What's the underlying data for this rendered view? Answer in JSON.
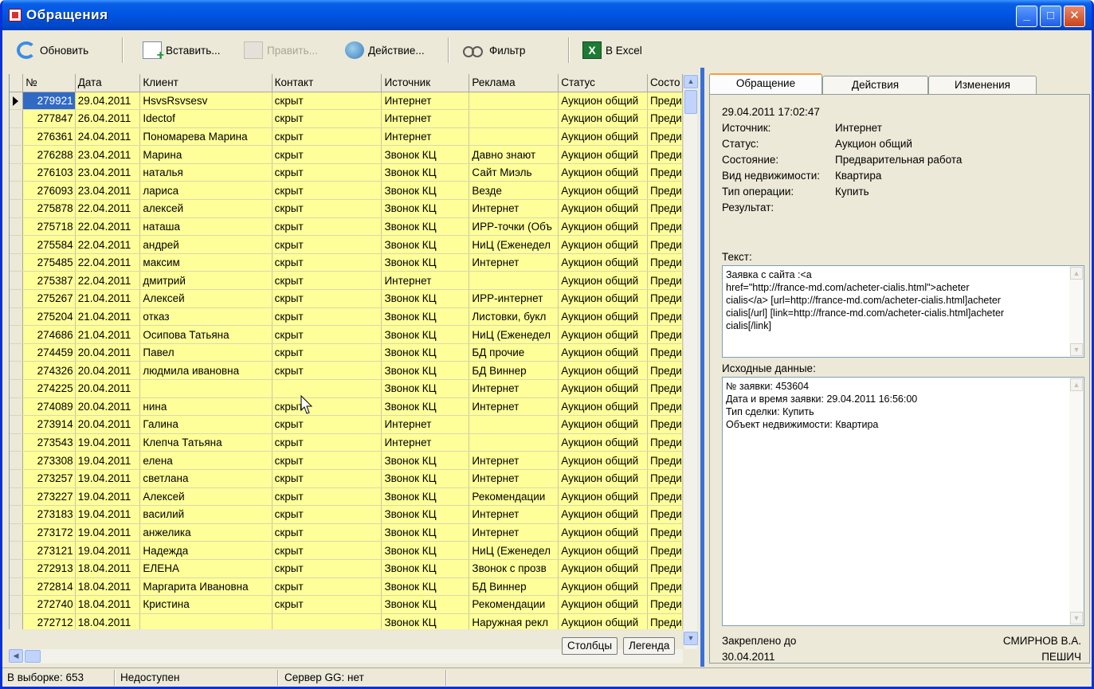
{
  "window": {
    "title": "Обращения"
  },
  "toolbar": {
    "refresh": "Обновить",
    "insert": "Вставить...",
    "edit": "Править...",
    "action": "Действие...",
    "filter": "Фильтр",
    "excel": "В Excel"
  },
  "grid": {
    "columns": [
      "№",
      "Дата",
      "Клиент",
      "Контакт",
      "Источник",
      "Реклама",
      "Статус",
      "Состо"
    ],
    "rows": [
      [
        "279921",
        "29.04.2011",
        "HsvsRsvsesv",
        "скрыт",
        "Интернет",
        "",
        "Аукцион общий",
        "Преди"
      ],
      [
        "277847",
        "26.04.2011",
        "Idectof",
        "скрыт",
        "Интернет",
        "",
        "Аукцион общий",
        "Преди"
      ],
      [
        "276361",
        "24.04.2011",
        "Пономарева Марина",
        "скрыт",
        "Интернет",
        "",
        "Аукцион общий",
        "Преди"
      ],
      [
        "276288",
        "23.04.2011",
        "Марина",
        "скрыт",
        "Звонок КЦ",
        "Давно знают",
        "Аукцион общий",
        "Преди"
      ],
      [
        "276103",
        "23.04.2011",
        "наталья",
        "скрыт",
        "Звонок КЦ",
        "Сайт Миэль",
        "Аукцион общий",
        "Преди"
      ],
      [
        "276093",
        "23.04.2011",
        "лариса",
        "скрыт",
        "Звонок КЦ",
        "Везде",
        "Аукцион общий",
        "Преди"
      ],
      [
        "275878",
        "22.04.2011",
        "алексей",
        "скрыт",
        "Звонок КЦ",
        "Интернет",
        "Аукцион общий",
        "Преди"
      ],
      [
        "275718",
        "22.04.2011",
        "наташа",
        "скрыт",
        "Звонок КЦ",
        "ИРР-точки (Объ",
        "Аукцион общий",
        "Преди"
      ],
      [
        "275584",
        "22.04.2011",
        "андрей",
        "скрыт",
        "Звонок КЦ",
        "НиЦ (Еженедел",
        "Аукцион общий",
        "Преди"
      ],
      [
        "275485",
        "22.04.2011",
        "максим",
        "скрыт",
        "Звонок КЦ",
        "Интернет",
        "Аукцион общий",
        "Преди"
      ],
      [
        "275387",
        "22.04.2011",
        "дмитрий",
        "скрыт",
        "Интернет",
        "",
        "Аукцион общий",
        "Преди"
      ],
      [
        "275267",
        "21.04.2011",
        "Алексей",
        "скрыт",
        "Звонок КЦ",
        "ИРР-интернет",
        "Аукцион общий",
        "Преди"
      ],
      [
        "275204",
        "21.04.2011",
        "отказ",
        "скрыт",
        "Звонок КЦ",
        "Листовки, букл",
        "Аукцион общий",
        "Преди"
      ],
      [
        "274686",
        "21.04.2011",
        "Осипова Татьяна",
        "скрыт",
        "Звонок КЦ",
        "НиЦ (Еженедел",
        "Аукцион общий",
        "Преди"
      ],
      [
        "274459",
        "20.04.2011",
        "Павел",
        "скрыт",
        "Звонок КЦ",
        "БД прочие",
        "Аукцион общий",
        "Преди"
      ],
      [
        "274326",
        "20.04.2011",
        "людмила ивановна",
        "скрыт",
        "Звонок КЦ",
        "БД Виннер",
        "Аукцион общий",
        "Преди"
      ],
      [
        "274225",
        "20.04.2011",
        "",
        "",
        "Звонок КЦ",
        "Интернет",
        "Аукцион общий",
        "Преди"
      ],
      [
        "274089",
        "20.04.2011",
        "нина",
        "скрыт",
        "Звонок КЦ",
        "Интернет",
        "Аукцион общий",
        "Преди"
      ],
      [
        "273914",
        "20.04.2011",
        "Галина",
        "скрыт",
        "Интернет",
        "",
        "Аукцион общий",
        "Преди"
      ],
      [
        "273543",
        "19.04.2011",
        "Клепча Татьяна",
        "скрыт",
        "Интернет",
        "",
        "Аукцион общий",
        "Преди"
      ],
      [
        "273308",
        "19.04.2011",
        "елена",
        "скрыт",
        "Звонок КЦ",
        "Интернет",
        "Аукцион общий",
        "Преди"
      ],
      [
        "273257",
        "19.04.2011",
        "светлана",
        "скрыт",
        "Звонок КЦ",
        "Интернет",
        "Аукцион общий",
        "Преди"
      ],
      [
        "273227",
        "19.04.2011",
        "Алексей",
        "скрыт",
        "Звонок КЦ",
        "Рекомендации",
        "Аукцион общий",
        "Преди"
      ],
      [
        "273183",
        "19.04.2011",
        "василий",
        "скрыт",
        "Звонок КЦ",
        "Интернет",
        "Аукцион общий",
        "Преди"
      ],
      [
        "273172",
        "19.04.2011",
        "анжелика",
        "скрыт",
        "Звонок КЦ",
        "Интернет",
        "Аукцион общий",
        "Преди"
      ],
      [
        "273121",
        "19.04.2011",
        "Надежда",
        "скрыт",
        "Звонок КЦ",
        "НиЦ (Еженедел",
        "Аукцион общий",
        "Преди"
      ],
      [
        "272913",
        "18.04.2011",
        "ЕЛЕНА",
        "скрыт",
        "Звонок КЦ",
        "Звонок с прозв",
        "Аукцион общий",
        "Преди"
      ],
      [
        "272814",
        "18.04.2011",
        "Маргарита Ивановна",
        "скрыт",
        "Звонок КЦ",
        "БД Виннер",
        "Аукцион общий",
        "Преди"
      ],
      [
        "272740",
        "18.04.2011",
        "Кристина",
        "скрыт",
        "Звонок КЦ",
        "Рекомендации",
        "Аукцион общий",
        "Преди"
      ],
      [
        "272712",
        "18.04.2011",
        "",
        "",
        "Звонок КЦ",
        "Наружная рекл",
        "Аукцион общий",
        "Преди"
      ]
    ],
    "selected_row": 0,
    "buttons": {
      "columns": "Столбцы",
      "legend": "Легенда"
    }
  },
  "detail": {
    "tabs": [
      "Обращение",
      "Действия",
      "Изменения"
    ],
    "active_tab": 0,
    "datetime": "29.04.2011 17:02:47",
    "fields": [
      {
        "label": "Источник:",
        "value": "Интернет"
      },
      {
        "label": "Статус:",
        "value": "Аукцион общий"
      },
      {
        "label": "Состояние:",
        "value": "Предварительная работа"
      },
      {
        "label": "Вид недвижимости:",
        "value": "Квартира"
      },
      {
        "label": "Тип операции:",
        "value": "Купить"
      },
      {
        "label": "Результат:",
        "value": ""
      }
    ],
    "text_label": "Текст:",
    "text_lines": [
      "Заявка с сайта :<a",
      "href=\"http://france-md.com/acheter-cialis.html\">acheter",
      "cialis</a> [url=http://france-md.com/acheter-cialis.html]acheter",
      "cialis[/url] [link=http://france-md.com/acheter-cialis.html]acheter",
      "cialis[/link]"
    ],
    "source_label": "Исходные данные:",
    "source_lines": [
      "№ заявки: 453604",
      "Дата и время заявки: 29.04.2011 16:56:00",
      "Тип сделки: Купить",
      "Объект недвижимости: Квартира"
    ],
    "pinned_label": "Закреплено до",
    "pinned_date": "30.04.2011",
    "agent_name": "СМИРНОВ В.А.",
    "agent_office": "ПЕШИЧ"
  },
  "status": {
    "selection": "В выборке: 653",
    "availability": "Недоступен",
    "server": "Сервер GG: нет"
  },
  "colors": {
    "row_bg": "#ffff99",
    "selection": "#316ac5",
    "titlebar": "#0054e3",
    "splitter": "#3b6fd8"
  }
}
